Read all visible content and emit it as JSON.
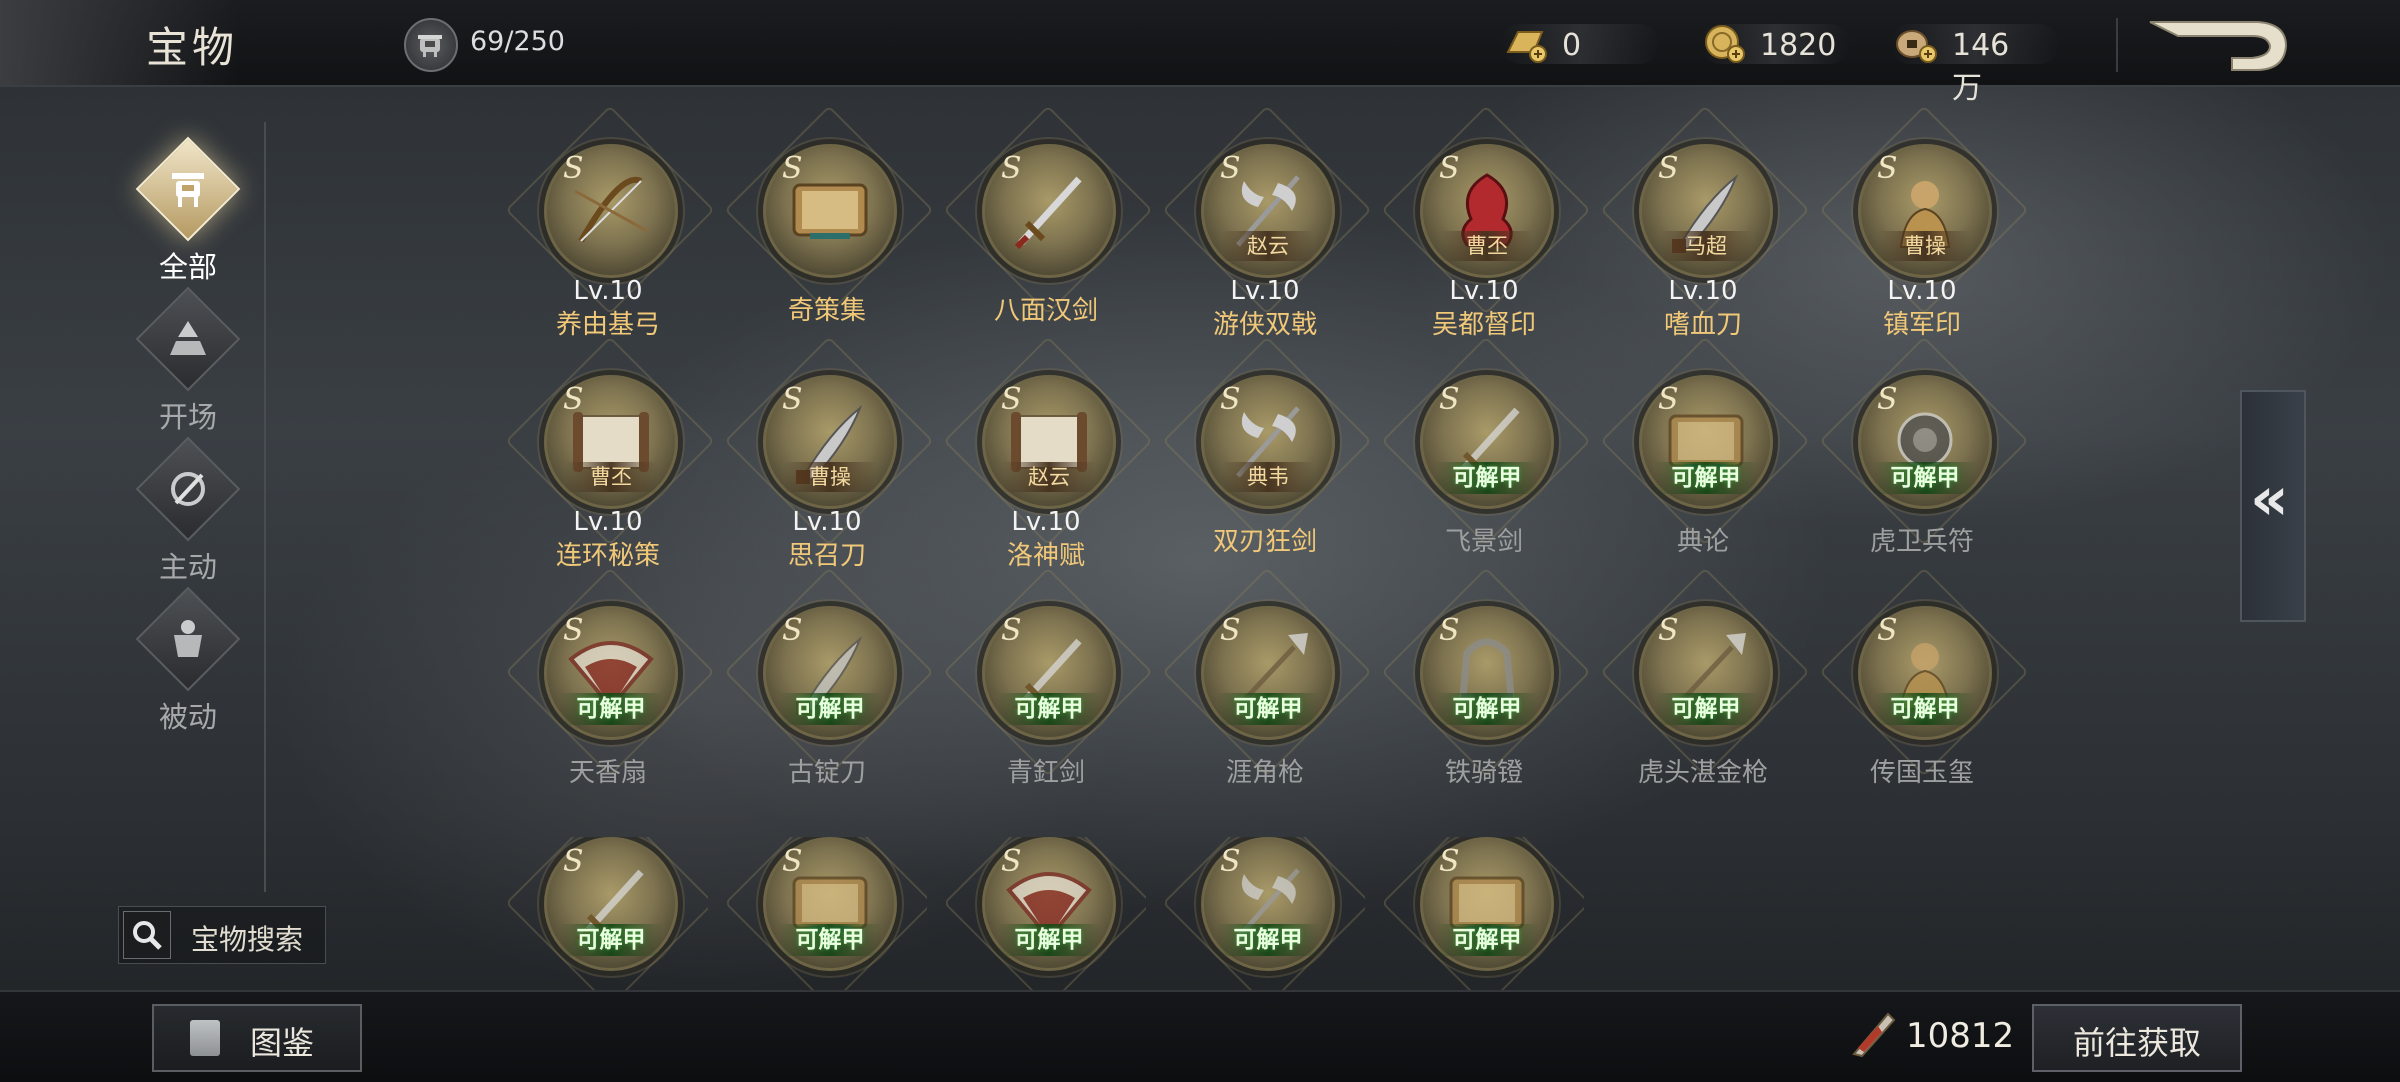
{
  "header": {
    "title": "宝物",
    "capacity": "69/250",
    "resources": [
      {
        "icon": "gold-bar-plus-icon",
        "value": "0"
      },
      {
        "icon": "gold-coin-plus-icon",
        "value": "1820"
      },
      {
        "icon": "copper-coin-plus-icon",
        "value": "146万"
      }
    ],
    "back_icon": "back-arrow-icon"
  },
  "sidebar": {
    "categories": [
      {
        "label": "全部",
        "icon": "cauldron-icon",
        "active": true
      },
      {
        "label": "开场",
        "icon": "pyramid-icon",
        "active": false
      },
      {
        "label": "主动",
        "icon": "slash-icon",
        "active": false
      },
      {
        "label": "被动",
        "icon": "armor-icon",
        "active": false
      }
    ],
    "search_label": "宝物搜索"
  },
  "grade_letter": "S",
  "treasures": [
    {
      "name": "养由基弓",
      "level": "Lv.10",
      "tag": "",
      "state": "owned",
      "art": "bow"
    },
    {
      "name": "奇策集",
      "level": "",
      "tag": "",
      "state": "owned",
      "art": "book"
    },
    {
      "name": "八面汉剑",
      "level": "",
      "tag": "",
      "state": "owned",
      "art": "sword"
    },
    {
      "name": "游侠双戟",
      "level": "Lv.10",
      "tag": "赵云",
      "state": "owned",
      "art": "halberd"
    },
    {
      "name": "吴都督印",
      "level": "Lv.10",
      "tag": "曹丕",
      "state": "owned",
      "art": "seal"
    },
    {
      "name": "嗜血刀",
      "level": "Lv.10",
      "tag": "马超",
      "state": "owned",
      "art": "blade"
    },
    {
      "name": "镇军印",
      "level": "Lv.10",
      "tag": "曹操",
      "state": "owned",
      "art": "statue"
    },
    {
      "name": "连环秘策",
      "level": "Lv.10",
      "tag": "曹丕",
      "state": "owned",
      "art": "scroll"
    },
    {
      "name": "思召刀",
      "level": "Lv.10",
      "tag": "曹操",
      "state": "owned",
      "art": "blade"
    },
    {
      "name": "洛神赋",
      "level": "Lv.10",
      "tag": "赵云",
      "state": "owned",
      "art": "scroll"
    },
    {
      "name": "双刃狂剑",
      "level": "",
      "tag": "典韦",
      "state": "owned",
      "art": "halberd"
    },
    {
      "name": "飞景剑",
      "level": "",
      "tag": "可解甲",
      "state": "locked",
      "art": "sword"
    },
    {
      "name": "典论",
      "level": "",
      "tag": "可解甲",
      "state": "locked",
      "art": "book"
    },
    {
      "name": "虎卫兵符",
      "level": "",
      "tag": "可解甲",
      "state": "locked",
      "art": "token"
    },
    {
      "name": "天香扇",
      "level": "",
      "tag": "可解甲",
      "state": "locked",
      "art": "fan"
    },
    {
      "name": "古锭刀",
      "level": "",
      "tag": "可解甲",
      "state": "locked",
      "art": "blade"
    },
    {
      "name": "青釭剑",
      "level": "",
      "tag": "可解甲",
      "state": "locked",
      "art": "sword"
    },
    {
      "name": "涯角枪",
      "level": "",
      "tag": "可解甲",
      "state": "locked",
      "art": "spear"
    },
    {
      "name": "铁骑镫",
      "level": "",
      "tag": "可解甲",
      "state": "locked",
      "art": "stirrup"
    },
    {
      "name": "虎头湛金枪",
      "level": "",
      "tag": "可解甲",
      "state": "locked",
      "art": "spear"
    },
    {
      "name": "传国玉玺",
      "level": "",
      "tag": "可解甲",
      "state": "locked",
      "art": "statue"
    },
    {
      "name": "",
      "level": "",
      "tag": "可解甲",
      "state": "locked",
      "art": "sword"
    },
    {
      "name": "",
      "level": "",
      "tag": "可解甲",
      "state": "locked",
      "art": "book"
    },
    {
      "name": "",
      "level": "",
      "tag": "可解甲",
      "state": "locked",
      "art": "fan"
    },
    {
      "name": "",
      "level": "",
      "tag": "可解甲",
      "state": "locked",
      "art": "halberd"
    },
    {
      "name": "",
      "level": "",
      "tag": "可解甲",
      "state": "locked",
      "art": "book"
    }
  ],
  "footer": {
    "gallery_label": "图鉴",
    "currency_icon": "quill-icon",
    "currency_value": "10812",
    "get_label": "前往获取"
  },
  "collapse_label": "«"
}
